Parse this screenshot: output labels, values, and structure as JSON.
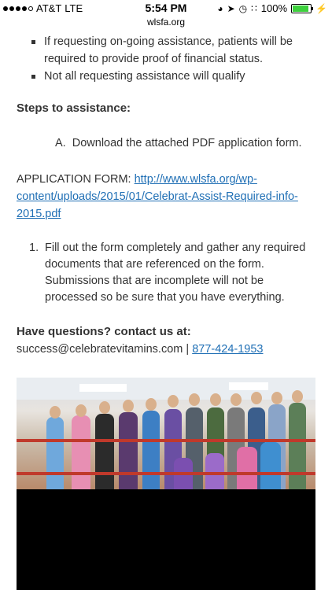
{
  "status_bar": {
    "carrier": "AT&T",
    "network": "LTE",
    "time": "5:54 PM",
    "url": "wlsfa.org",
    "battery": "100%",
    "battery_level": 1.0
  },
  "bullets": [
    "If requesting on-going assistance, patients will be required to provide proof of financial status.",
    "Not all requesting assistance will qualify"
  ],
  "steps_heading": "Steps to assistance:",
  "step_a": {
    "marker": "A.",
    "text": "Download the attached PDF application form."
  },
  "application_form": {
    "label": "APPLICATION FORM: ",
    "link_text": "http://www.wlsfa.org/wp-content/uploads/2015/01/Celebrat-Assist-Required-info-2015.pdf"
  },
  "step_1": {
    "marker": "1.",
    "text": "Fill out the form completely and gather any required documents that are referenced on the form. Submissions that are incomplete will not be processed so be sure that you have everything."
  },
  "questions_heading": "Have questions? contact us at:",
  "contact": {
    "email": "success@celebratevitamins.com",
    "separator": " | ",
    "phone": "877-424-1953"
  },
  "colors": {
    "link": "#1f6fb5",
    "text": "#333333",
    "battery": "#3dd13d"
  }
}
